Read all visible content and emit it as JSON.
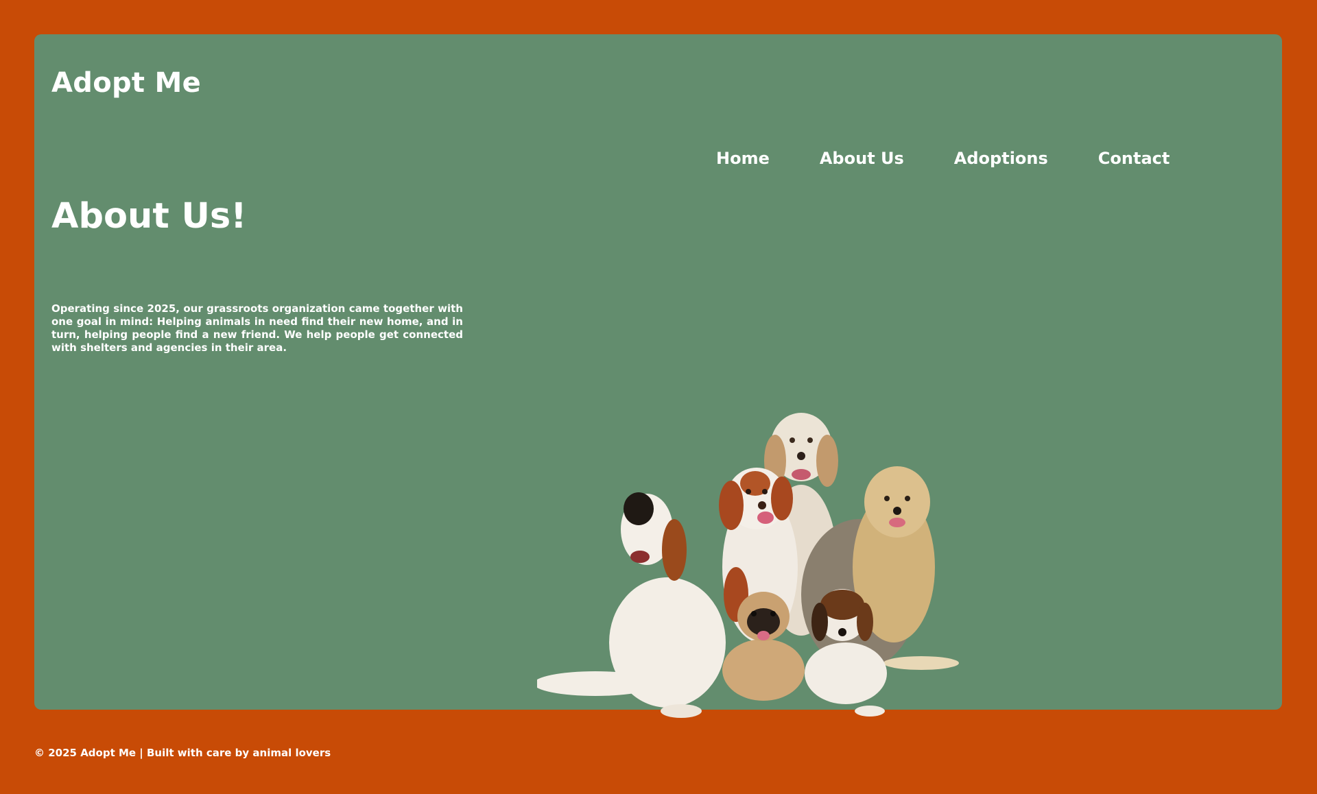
{
  "site": {
    "title": "Adopt Me"
  },
  "nav": {
    "items": [
      {
        "label": "Home"
      },
      {
        "label": "About Us"
      },
      {
        "label": "Adoptions"
      },
      {
        "label": "Contact"
      }
    ]
  },
  "main": {
    "heading": "About Us!",
    "body": "Operating since 2025, our grassroots organization came together with one goal in mind: Helping animals in need find their new home, and in turn, helping people find a new friend. We help people get connected with shelters and agencies in their area."
  },
  "footer": {
    "text": "© 2025 Adopt Me | Built with care by animal lovers"
  },
  "colors": {
    "page_background": "#c84b06",
    "card_background": "#638d6e",
    "text": "#ffffff"
  }
}
